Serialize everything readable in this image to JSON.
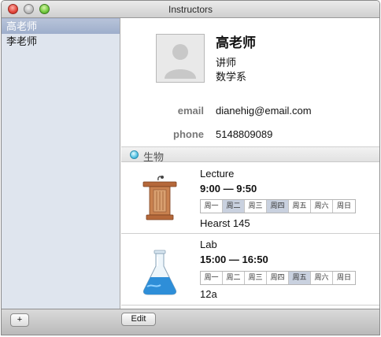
{
  "window": {
    "title": "Instructors"
  },
  "sidebar": {
    "items": [
      {
        "label": "高老师",
        "selected": true
      },
      {
        "label": "李老师",
        "selected": false
      }
    ]
  },
  "profile": {
    "name": "高老师",
    "role": "讲师",
    "department": "数学系",
    "email_label": "email",
    "email": "dianehig@email.com",
    "phone_label": "phone",
    "phone": "5148809089"
  },
  "section": {
    "title": "生物",
    "dot_color": "#54c3e4"
  },
  "courses": [
    {
      "type": "Lecture",
      "time": "9:00 — 9:50",
      "room": "Hearst 145",
      "icon": "podium-icon",
      "days": [
        {
          "label": "周一",
          "active": false
        },
        {
          "label": "周二",
          "active": true
        },
        {
          "label": "周三",
          "active": false
        },
        {
          "label": "周四",
          "active": true
        },
        {
          "label": "周五",
          "active": false
        },
        {
          "label": "周六",
          "active": false
        },
        {
          "label": "周日",
          "active": false
        }
      ]
    },
    {
      "type": "Lab",
      "time": "15:00 — 16:50",
      "room": "12a",
      "icon": "flask-icon",
      "days": [
        {
          "label": "周一",
          "active": false
        },
        {
          "label": "周二",
          "active": false
        },
        {
          "label": "周三",
          "active": false
        },
        {
          "label": "周四",
          "active": false
        },
        {
          "label": "周五",
          "active": true
        },
        {
          "label": "周六",
          "active": false
        },
        {
          "label": "周日",
          "active": false
        }
      ]
    }
  ],
  "bottombar": {
    "add_label": "+",
    "edit_label": "Edit"
  }
}
